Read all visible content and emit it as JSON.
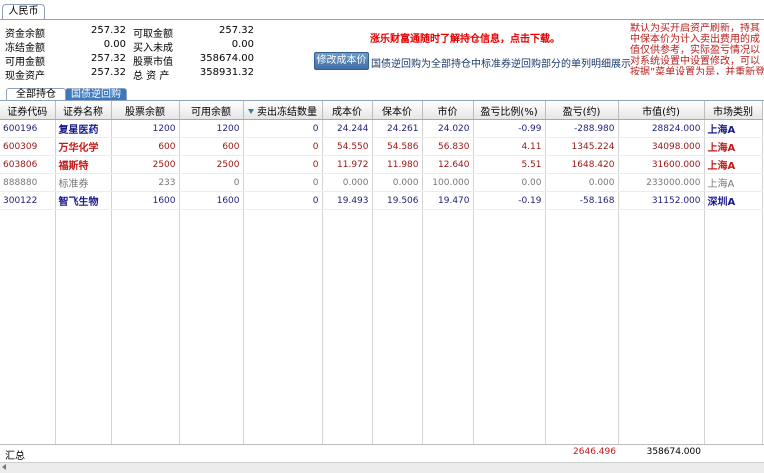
{
  "currency_tab": "人民币",
  "summary": {
    "col1": [
      {
        "label": "资金余额",
        "value": "257.32"
      },
      {
        "label": "冻结金额",
        "value": "0.00"
      },
      {
        "label": "可用金额",
        "value": "257.32"
      },
      {
        "label": "现金资产",
        "value": "257.32"
      }
    ],
    "col2": [
      {
        "label": "可取金额",
        "value": "257.32"
      },
      {
        "label": "买入未成",
        "value": "0.00"
      },
      {
        "label": "股票市值",
        "value": "358674.00"
      },
      {
        "label": "总 资 产",
        "value": "358931.32"
      }
    ]
  },
  "promo_text": "涨乐财富通随时了解持仓信息，点击下载。",
  "cost_button": "修改成本价",
  "cost_desc": "国债逆回购为全部持仓中标准券逆回购部分的单列明细展示",
  "side_note": "默认为买开启资产刷新，持其中保本价为计入卖出费用的成值仅供参考，实际盈亏情况以对系统设置中设置修改，可以按据”菜单设置为是，并重新登录",
  "tabs": {
    "all": "全部持仓",
    "bond": "国债逆回购"
  },
  "columns": [
    "证券代码",
    "证券名称",
    "股票余额",
    "可用余额",
    "卖出冻结数量",
    "成本价",
    "保本价",
    "市价",
    "盈亏比例(%)",
    "盈亏(约)",
    "市值(约)",
    "市场类别"
  ],
  "rows": [
    {
      "code": "600196",
      "name": "复星医药",
      "balance": "1200",
      "available": "1200",
      "frozen": "0",
      "cost": "24.244",
      "breakeven": "24.261",
      "price": "24.020",
      "pnl_pct": "-0.99",
      "pnl": "-288.980",
      "mv": "28824.000",
      "market": "上海A",
      "style": "blue"
    },
    {
      "code": "600309",
      "name": "万华化学",
      "balance": "600",
      "available": "600",
      "frozen": "0",
      "cost": "54.550",
      "breakeven": "54.586",
      "price": "56.830",
      "pnl_pct": "4.11",
      "pnl": "1345.224",
      "mv": "34098.000",
      "market": "上海A",
      "style": "red"
    },
    {
      "code": "603806",
      "name": "福斯特",
      "balance": "2500",
      "available": "2500",
      "frozen": "0",
      "cost": "11.972",
      "breakeven": "11.980",
      "price": "12.640",
      "pnl_pct": "5.51",
      "pnl": "1648.420",
      "mv": "31600.000",
      "market": "上海A",
      "style": "red"
    },
    {
      "code": "888880",
      "name": "标准券",
      "balance": "233",
      "available": "0",
      "frozen": "0",
      "cost": "0.000",
      "breakeven": "0.000",
      "price": "100.000",
      "pnl_pct": "0.00",
      "pnl": "0.000",
      "mv": "233000.000",
      "market": "上海A",
      "style": "gray"
    },
    {
      "code": "300122",
      "name": "智飞生物",
      "balance": "1600",
      "available": "1600",
      "frozen": "0",
      "cost": "19.493",
      "breakeven": "19.506",
      "price": "19.470",
      "pnl_pct": "-0.19",
      "pnl": "-58.168",
      "mv": "31152.000",
      "market": "深圳A",
      "style": "blue"
    }
  ],
  "totals": {
    "label": "汇总",
    "pnl": "2646.496",
    "mv": "358674.000"
  },
  "colors": {
    "loss_blue": "#1f1f7a",
    "gain_red": "#9b1414",
    "accent": "#3d79bf"
  }
}
